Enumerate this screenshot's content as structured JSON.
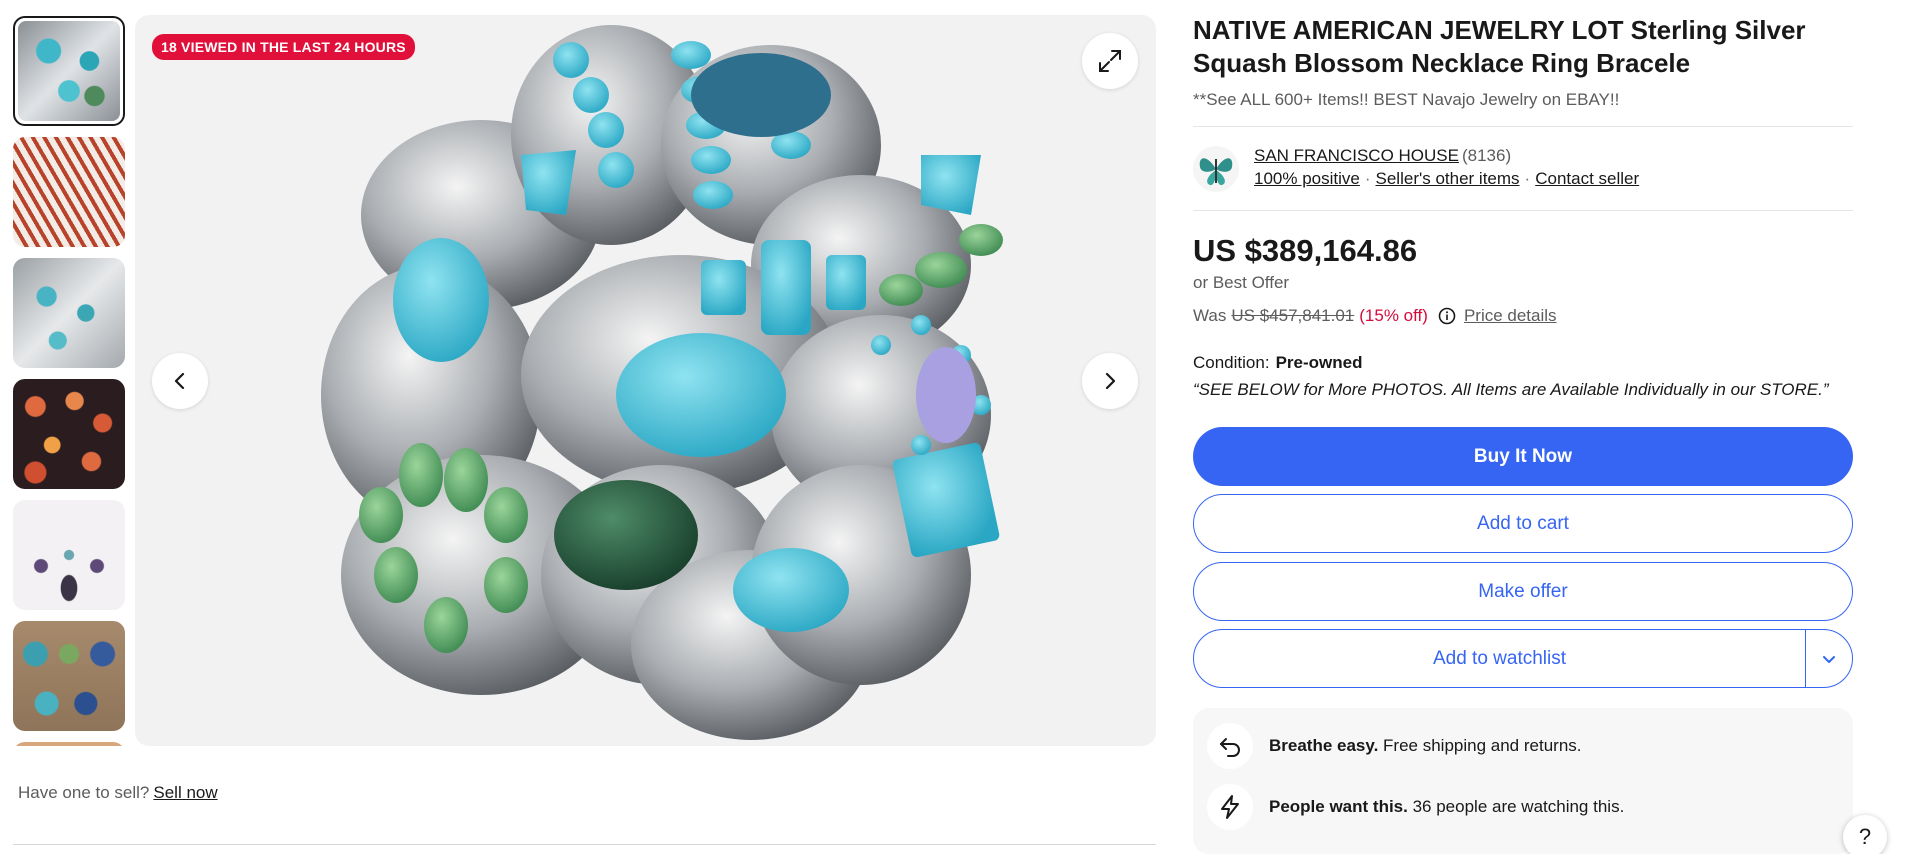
{
  "gallery": {
    "viewed_badge": "18 VIEWED IN THE LAST 24 HOURS",
    "thumbnails": [
      "turquoise-cuffs",
      "coral-necklaces",
      "turquoise-rings",
      "spiny-oyster-pieces",
      "squash-blossom-necklace",
      "assorted-rings",
      "partial-thumbnail"
    ]
  },
  "sell_prompt": {
    "text": "Have one to sell?",
    "link": "Sell now"
  },
  "listing": {
    "title": "NATIVE AMERICAN JEWELRY LOT Sterling Silver Squash Blossom Necklace Ring Bracele",
    "subtitle": "**See ALL 600+ Items!! BEST Navajo Jewelry on EBAY!!"
  },
  "seller": {
    "name": "SAN FRANCISCO HOUSE",
    "feedback_count": "(8136)",
    "positive": "100% positive",
    "other_items": "Seller's other items",
    "contact": "Contact seller"
  },
  "pricing": {
    "price": "US $389,164.86",
    "best_offer": "or Best Offer",
    "was_label": "Was",
    "original_price": "US $457,841.01",
    "discount": "(15% off)",
    "price_details": "Price details"
  },
  "condition": {
    "label": "Condition:",
    "value": "Pre-owned",
    "description": "“SEE BELOW for More PHOTOS. All Items are Available Individually in our STORE.”"
  },
  "actions": {
    "buy_now": "Buy It Now",
    "add_to_cart": "Add to cart",
    "make_offer": "Make offer",
    "add_to_watchlist": "Add to watchlist"
  },
  "highlights": [
    {
      "bold": "Breathe easy.",
      "text": "Free shipping and returns."
    },
    {
      "bold": "People want this.",
      "text": "36 people are watching this."
    }
  ],
  "help_label": "?",
  "colors": {
    "accent_blue": "#3665f3",
    "badge_red": "#e0103a",
    "discount_red": "#d50b3c"
  }
}
